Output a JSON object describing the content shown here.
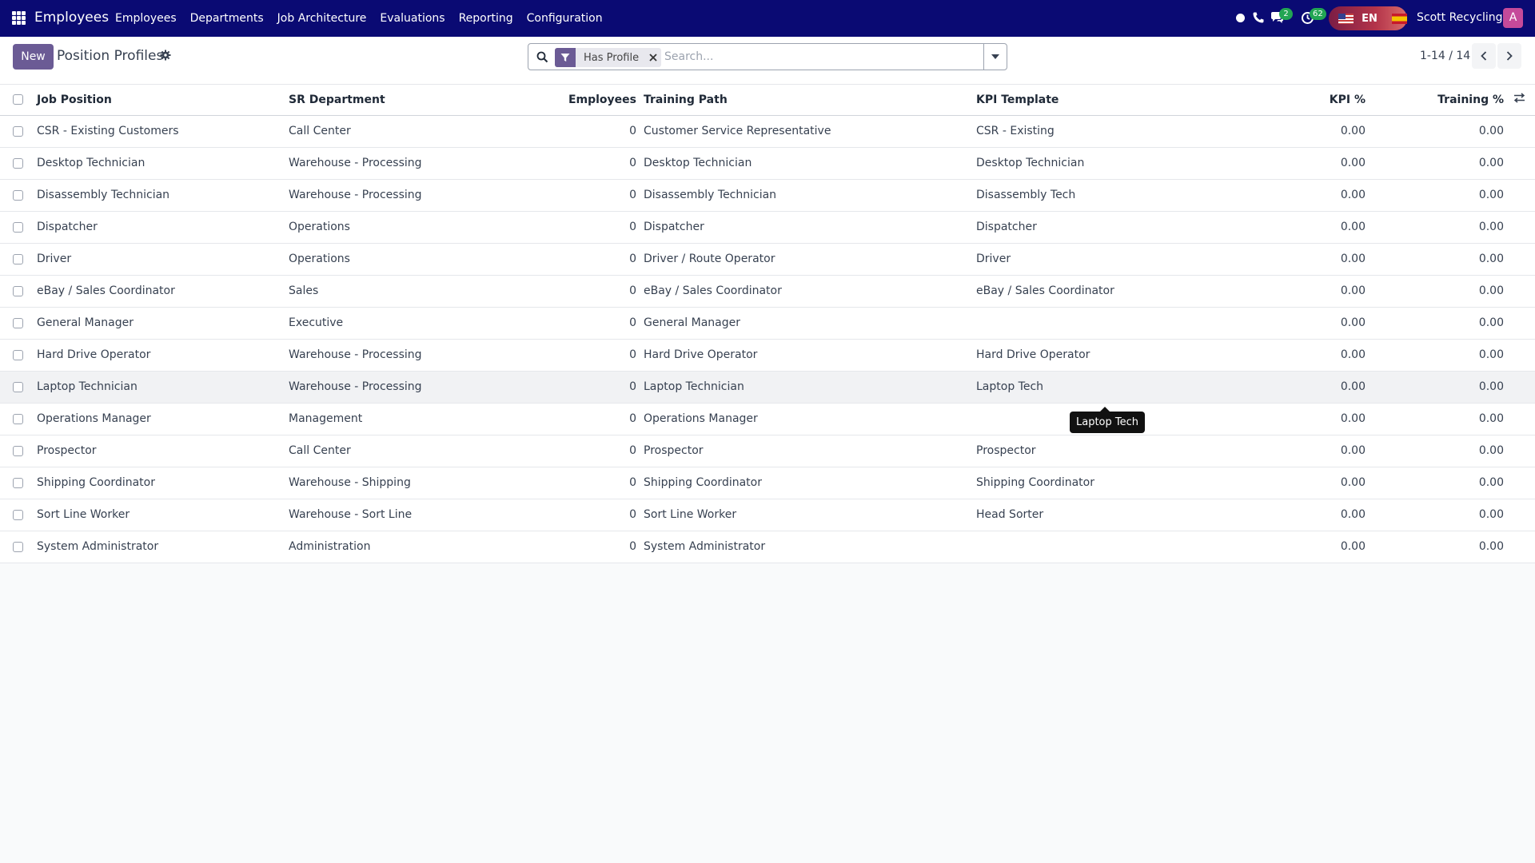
{
  "app": {
    "name": "Employees"
  },
  "navbar": {
    "menu": [
      "Employees",
      "Departments",
      "Job Architecture",
      "Evaluations",
      "Reporting",
      "Configuration"
    ],
    "chat_count": "2",
    "activity_count": "62",
    "language": "EN",
    "company": "Scott Recycling",
    "avatar_letter": "A",
    "accent": "#0a0a73"
  },
  "control": {
    "new_label": "New",
    "title": "Position Profiles",
    "facet_label": "Has Profile",
    "search_placeholder": "Search...",
    "pager": "1-14 / 14"
  },
  "table": {
    "headers": {
      "job": "Job Position",
      "dept": "SR Department",
      "employees": "Employees",
      "path": "Training Path",
      "kpi": "KPI Template",
      "kpi_pct": "KPI %",
      "training_pct": "Training %"
    },
    "rows": [
      {
        "job": "CSR - Existing Customers",
        "dept": "Call Center",
        "employees": "0",
        "path": "Customer Service Representative",
        "kpi": "CSR - Existing",
        "kpi_pct": "0.00",
        "training_pct": "0.00"
      },
      {
        "job": "Desktop Technician",
        "dept": "Warehouse - Processing",
        "employees": "0",
        "path": "Desktop Technician",
        "kpi": "Desktop Technician",
        "kpi_pct": "0.00",
        "training_pct": "0.00"
      },
      {
        "job": "Disassembly Technician",
        "dept": "Warehouse - Processing",
        "employees": "0",
        "path": "Disassembly Technician",
        "kpi": "Disassembly Tech",
        "kpi_pct": "0.00",
        "training_pct": "0.00"
      },
      {
        "job": "Dispatcher",
        "dept": "Operations",
        "employees": "0",
        "path": "Dispatcher",
        "kpi": "Dispatcher",
        "kpi_pct": "0.00",
        "training_pct": "0.00"
      },
      {
        "job": "Driver",
        "dept": "Operations",
        "employees": "0",
        "path": "Driver / Route Operator",
        "kpi": "Driver",
        "kpi_pct": "0.00",
        "training_pct": "0.00"
      },
      {
        "job": "eBay / Sales Coordinator",
        "dept": "Sales",
        "employees": "0",
        "path": "eBay / Sales Coordinator",
        "kpi": "eBay / Sales Coordinator",
        "kpi_pct": "0.00",
        "training_pct": "0.00"
      },
      {
        "job": "General Manager",
        "dept": "Executive",
        "employees": "0",
        "path": "General Manager",
        "kpi": "",
        "kpi_pct": "0.00",
        "training_pct": "0.00"
      },
      {
        "job": "Hard Drive Operator",
        "dept": "Warehouse - Processing",
        "employees": "0",
        "path": "Hard Drive Operator",
        "kpi": "Hard Drive Operator",
        "kpi_pct": "0.00",
        "training_pct": "0.00"
      },
      {
        "job": "Laptop Technician",
        "dept": "Warehouse - Processing",
        "employees": "0",
        "path": "Laptop Technician",
        "kpi": "Laptop Tech",
        "kpi_pct": "0.00",
        "training_pct": "0.00"
      },
      {
        "job": "Operations Manager",
        "dept": "Management",
        "employees": "0",
        "path": "Operations Manager",
        "kpi": "",
        "kpi_pct": "0.00",
        "training_pct": "0.00"
      },
      {
        "job": "Prospector",
        "dept": "Call Center",
        "employees": "0",
        "path": "Prospector",
        "kpi": "Prospector",
        "kpi_pct": "0.00",
        "training_pct": "0.00"
      },
      {
        "job": "Shipping Coordinator",
        "dept": "Warehouse - Shipping",
        "employees": "0",
        "path": "Shipping Coordinator",
        "kpi": "Shipping Coordinator",
        "kpi_pct": "0.00",
        "training_pct": "0.00"
      },
      {
        "job": "Sort Line Worker",
        "dept": "Warehouse - Sort Line",
        "employees": "0",
        "path": "Sort Line Worker",
        "kpi": "Head Sorter",
        "kpi_pct": "0.00",
        "training_pct": "0.00"
      },
      {
        "job": "System Administrator",
        "dept": "Administration",
        "employees": "0",
        "path": "System Administrator",
        "kpi": "",
        "kpi_pct": "0.00",
        "training_pct": "0.00"
      }
    ]
  },
  "tooltip": {
    "text": "Laptop Tech"
  }
}
